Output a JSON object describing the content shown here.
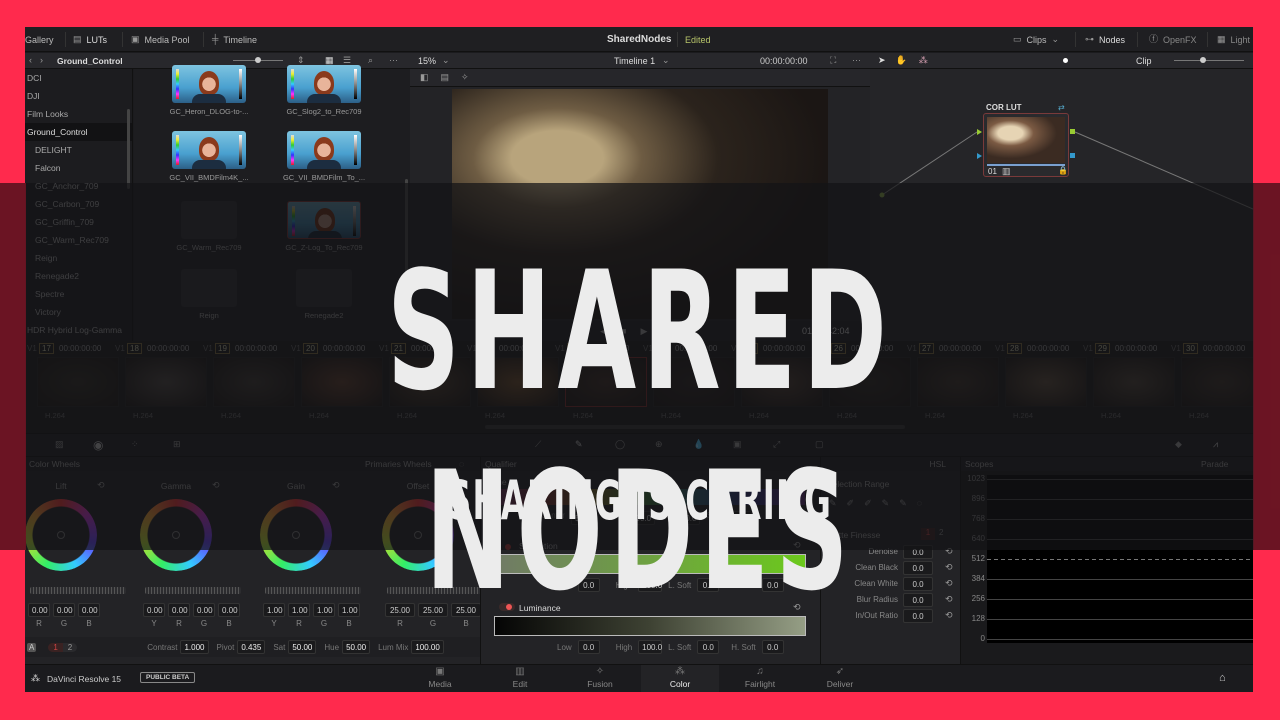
{
  "topbar": {
    "items": [
      {
        "label": "Gallery",
        "icon": "gallery-icon"
      },
      {
        "label": "LUTs",
        "icon": "luts-icon"
      },
      {
        "label": "Media Pool",
        "icon": "media-pool-icon"
      },
      {
        "label": "Timeline",
        "icon": "timeline-icon"
      }
    ],
    "project_title": "SharedNodes",
    "project_status": "Edited",
    "right_items": [
      {
        "label": "Clips",
        "icon": "clips-icon"
      },
      {
        "label": "Nodes",
        "icon": "nodes-icon"
      },
      {
        "label": "OpenFX",
        "icon": "openfx-icon"
      },
      {
        "label": "Light",
        "icon": "lightbox-icon"
      }
    ]
  },
  "luts": {
    "breadcrumb": "Ground_Control",
    "folders": [
      {
        "label": "DCI",
        "level": 0
      },
      {
        "label": "DJI",
        "level": 0
      },
      {
        "label": "Film Looks",
        "level": 0
      },
      {
        "label": "Ground_Control",
        "level": 0,
        "selected": true
      },
      {
        "label": "DELIGHT",
        "level": 1
      },
      {
        "label": "Falcon",
        "level": 1
      },
      {
        "label": "GC_Anchor_709",
        "level": 1
      },
      {
        "label": "GC_Carbon_709",
        "level": 1
      },
      {
        "label": "GC_Griffin_709",
        "level": 1
      },
      {
        "label": "GC_Warm_Rec709",
        "level": 1
      },
      {
        "label": "Reign",
        "level": 1
      },
      {
        "label": "Renegade2",
        "level": 1
      },
      {
        "label": "Spectre",
        "level": 1
      },
      {
        "label": "Victory",
        "level": 1
      },
      {
        "label": "HDR Hybrid Log-Gamma",
        "level": 0
      }
    ],
    "thumbnails": [
      {
        "label": "GC_Heron_DLOG-to-..."
      },
      {
        "label": "GC_Slog2_to_Rec709"
      },
      {
        "label": "GC_VII_BMDFilm4K_..."
      },
      {
        "label": "GC_VII_BMDFilm_To_..."
      },
      {
        "label": "GC_Warm_Rec709",
        "type": "folder"
      },
      {
        "label": "GC_Z-Log_To_Rec709",
        "selected": true
      },
      {
        "label": "Reign",
        "type": "folder"
      },
      {
        "label": "Renegade2",
        "type": "folder"
      }
    ]
  },
  "viewer": {
    "zoom": "15%",
    "timeline_name": "Timeline 1",
    "timecode": "00:00:00:00",
    "playhead_timecode": "01:00:42:04"
  },
  "nodes": {
    "mode": "Clip",
    "node_label": "COR LUT",
    "node_number": "01"
  },
  "timeline": {
    "clips": [
      {
        "track": "V1",
        "number": "17",
        "timecode": "00:00:00:00",
        "codec": "H.264"
      },
      {
        "track": "V1",
        "number": "18",
        "timecode": "00:00:00:00",
        "codec": "H.264"
      },
      {
        "track": "V1",
        "number": "19",
        "timecode": "00:00:00:00",
        "codec": "H.264"
      },
      {
        "track": "V1",
        "number": "20",
        "timecode": "00:00:00:00",
        "codec": "H.264"
      },
      {
        "track": "V1",
        "number": "21",
        "timecode": "00:00:00:00",
        "codec": "H.264"
      },
      {
        "track": "V1",
        "number": "22",
        "timecode": "00:00:00:00",
        "codec": "H.264"
      },
      {
        "track": "V1",
        "number": "23",
        "timecode": "00:00:00:00",
        "codec": "H.264"
      },
      {
        "track": "V1",
        "number": "24",
        "timecode": "00:00:00:00",
        "codec": "H.264"
      },
      {
        "track": "V1",
        "number": "25",
        "timecode": "00:00:00:00",
        "codec": "H.264"
      },
      {
        "track": "V1",
        "number": "26",
        "timecode": "00:00:00:00",
        "codec": "H.264"
      },
      {
        "track": "V1",
        "number": "27",
        "timecode": "00:00:00:00",
        "codec": "H.264"
      },
      {
        "track": "V1",
        "number": "28",
        "timecode": "00:00:00:00",
        "codec": "H.264"
      },
      {
        "track": "V1",
        "number": "29",
        "timecode": "00:00:00:00",
        "codec": "H.264"
      },
      {
        "track": "V1",
        "number": "30",
        "timecode": "00:00:00:00",
        "codec": "H.264"
      }
    ]
  },
  "wheels": {
    "title": "Color Wheels",
    "mode": "Primaries Wheels",
    "wheels": [
      {
        "name": "Lift",
        "channels": [
          "R",
          "G",
          "B"
        ],
        "values": [
          "0.00",
          "0.00",
          "0.00"
        ]
      },
      {
        "name": "Gamma",
        "channels": [
          "Y",
          "R",
          "G",
          "B"
        ],
        "values": [
          "0.00",
          "0.00",
          "0.00",
          "0.00"
        ]
      },
      {
        "name": "Gain",
        "channels": [
          "Y",
          "R",
          "G",
          "B"
        ],
        "values": [
          "1.00",
          "1.00",
          "1.00",
          "1.00"
        ]
      },
      {
        "name": "Offset",
        "channels": [
          "R",
          "G",
          "B"
        ],
        "values": [
          "25.00",
          "25.00",
          "25.00"
        ]
      }
    ],
    "pages": [
      "1",
      "2"
    ],
    "contrast_label": "Contrast",
    "contrast": "1.000",
    "pivot_label": "Pivot",
    "pivot": "0.435",
    "sat_label": "Sat",
    "sat": "50.00",
    "hue_label": "Hue",
    "hue": "50.00",
    "lummix_label": "Lum Mix",
    "lummix": "100.00"
  },
  "qualifier": {
    "title": "Qualifier",
    "mode": "HSL",
    "hue": {
      "label": "Hue",
      "center_label": "Center",
      "center": "50.0",
      "width_label": "Width",
      "width": "100.0",
      "soft_label": "Soft",
      "soft": "0.0",
      "sym_label": "Sym",
      "sym": "50.0"
    },
    "saturation": {
      "label": "Saturation",
      "low_label": "Low",
      "low": "0.0",
      "high_label": "High",
      "high": "100.0",
      "lsoft_label": "L. Soft",
      "lsoft": "0.0",
      "hsoft_label": "H. Soft",
      "hsoft": "0.0"
    },
    "luminance": {
      "label": "Luminance",
      "low_label": "Low",
      "low": "0.0",
      "high_label": "High",
      "high": "100.0",
      "lsoft_label": "L. Soft",
      "lsoft": "0.0",
      "hsoft_label": "H. Soft",
      "hsoft": "0.0"
    }
  },
  "matte": {
    "selection_range": "Selection Range",
    "matte_finesse": "Matte Finesse",
    "pages": [
      "1",
      "2"
    ],
    "rows": [
      {
        "label": "Denoise",
        "value": "0.0"
      },
      {
        "label": "Clean Black",
        "value": "0.0"
      },
      {
        "label": "Clean White",
        "value": "0.0"
      },
      {
        "label": "Blur Radius",
        "value": "0.0"
      },
      {
        "label": "In/Out Ratio",
        "value": "0.0"
      }
    ]
  },
  "scopes": {
    "title": "Scopes",
    "mode": "Parade",
    "scale": [
      "1023",
      "896",
      "768",
      "640",
      "512",
      "384",
      "256",
      "128",
      "0"
    ]
  },
  "bottombar": {
    "app_name": "DaVinci Resolve 15",
    "badge": "PUBLIC BETA",
    "pages": [
      {
        "label": "Media",
        "icon": "media-page-icon"
      },
      {
        "label": "Edit",
        "icon": "edit-page-icon"
      },
      {
        "label": "Fusion",
        "icon": "fusion-page-icon"
      },
      {
        "label": "Color",
        "icon": "color-page-icon",
        "active": true
      },
      {
        "label": "Fairlight",
        "icon": "fairlight-page-icon"
      },
      {
        "label": "Deliver",
        "icon": "deliver-page-icon"
      }
    ]
  },
  "overlay": {
    "title": "SHARED NODES",
    "subtitle": "SHARING IS CARING"
  },
  "colors": {
    "frame": "#ff2a4d",
    "edited": "#b7c46a",
    "selected_border": "#a04040"
  }
}
